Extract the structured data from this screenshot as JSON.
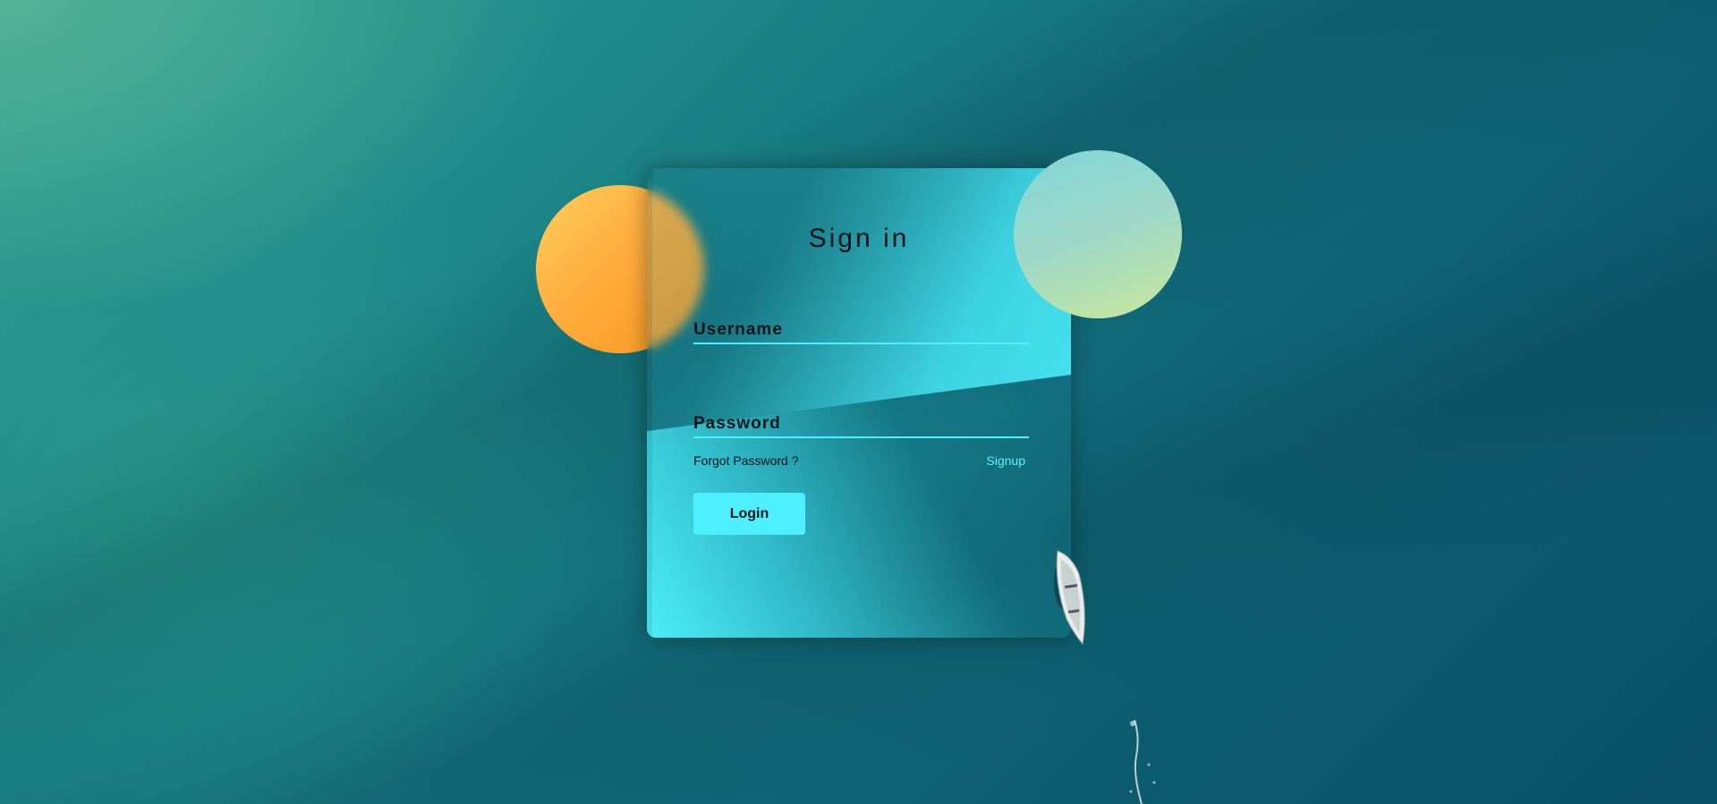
{
  "background": {
    "description_colors": {
      "light": "#2f9f92",
      "dark": "#0a5266"
    }
  },
  "decor": {
    "circle_left_color": "#f8941e",
    "circle_right_color": "#9fd8c8"
  },
  "form": {
    "title": "Sign in",
    "username_label": "Username",
    "username_value": "",
    "password_label": "Password",
    "password_value": "",
    "forgot_label": "Forgot Password ?",
    "signup_label": "Signup",
    "login_label": "Login",
    "accent_color": "#4ef0ff"
  }
}
